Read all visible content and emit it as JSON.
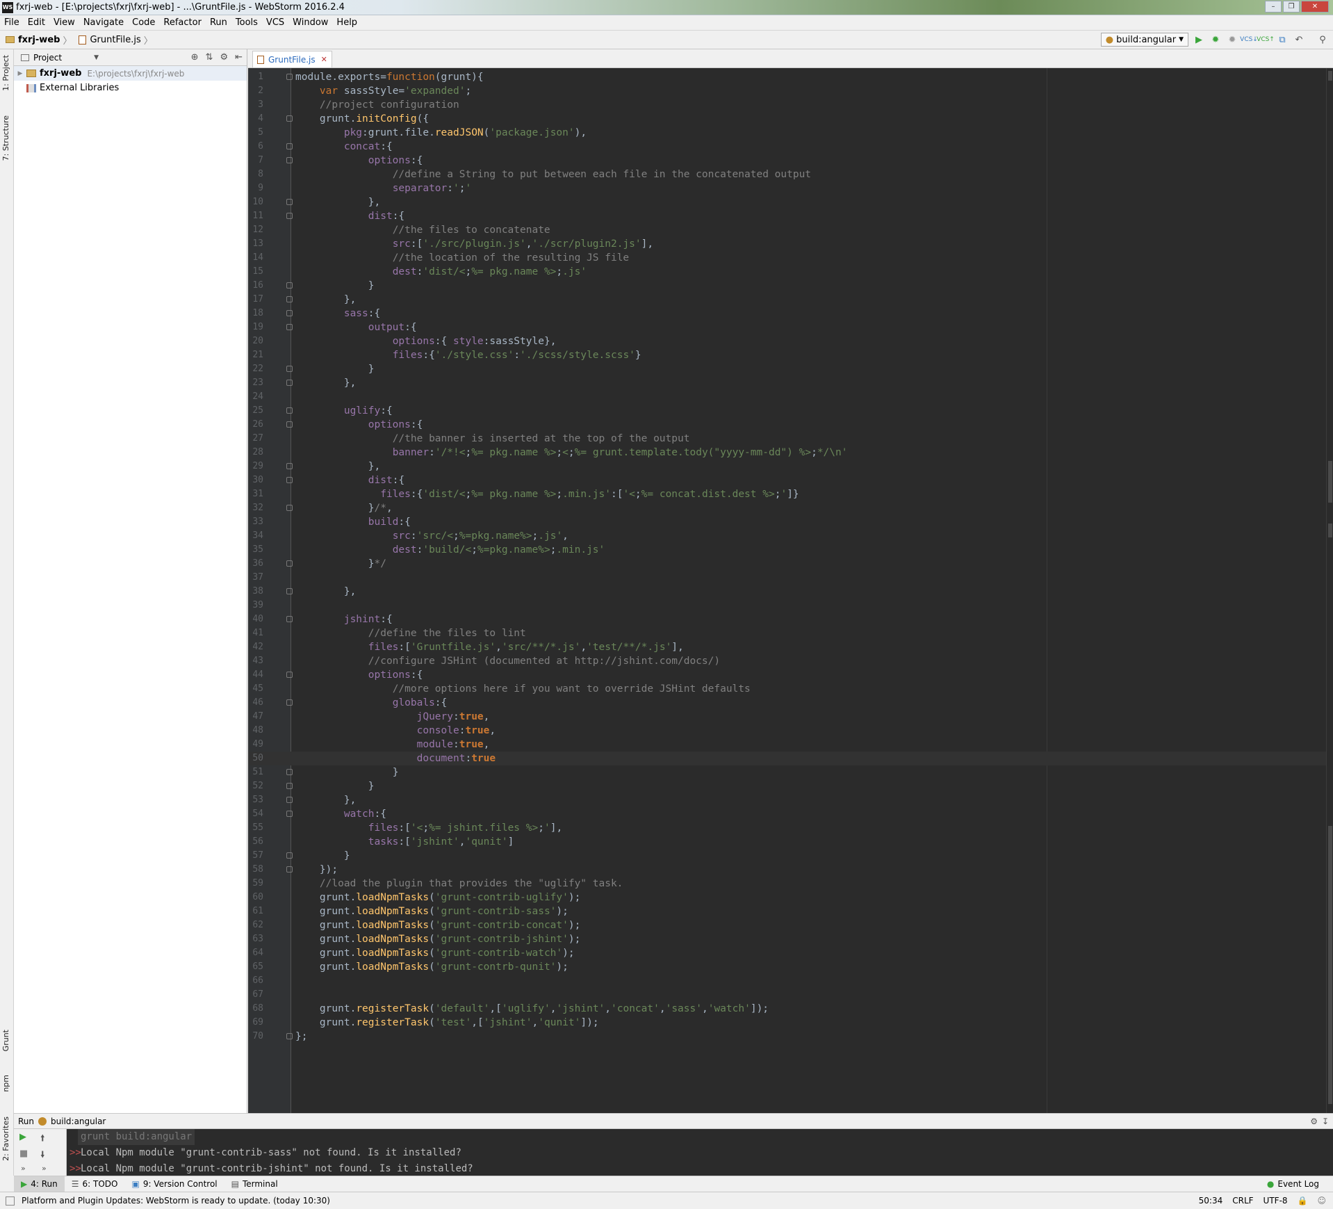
{
  "window": {
    "title": "fxrj-web - [E:\\projects\\fxrj\\fxrj-web] - ...\\GruntFile.js - WebStorm 2016.2.4",
    "app_icon": "WS",
    "buttons": [
      "minimize-icon",
      "restore-icon",
      "close-icon"
    ]
  },
  "menu": [
    "File",
    "Edit",
    "View",
    "Navigate",
    "Code",
    "Refactor",
    "Run",
    "Tools",
    "VCS",
    "Window",
    "Help"
  ],
  "breadcrumb": {
    "project": "fxrj-web",
    "file": "GruntFile.js"
  },
  "toolbar": {
    "run_config": "build:angular",
    "icons": [
      "run-icon",
      "debug-icon",
      "coverage-icon",
      "vcs-update-icon",
      "vcs-commit-icon",
      "compare-icon",
      "revert-icon",
      "search-icon"
    ]
  },
  "left_tabs": {
    "project": "1: Project",
    "structure": "7: Structure",
    "grunt": "Grunt",
    "npm": "npm",
    "favorites": "2: Favorites"
  },
  "project_panel": {
    "header": "Project",
    "tree": [
      {
        "label": "fxrj-web",
        "path": "E:\\projects\\fxrj\\fxrj-web"
      },
      {
        "label": "External Libraries",
        "path": ""
      }
    ]
  },
  "editor": {
    "tab": "GruntFile.js",
    "current_line": 50,
    "lines": [
      "module.exports=function(grunt){",
      "    var sassStyle='expanded';",
      "    //project configuration",
      "    grunt.initConfig({",
      "        pkg:grunt.file.readJSON('package.json'),",
      "        concat:{",
      "            options:{",
      "                //define a String to put between each file in the concatenated output",
      "                separator:';'",
      "            },",
      "            dist:{",
      "                //the files to concatenate",
      "                src:['./src/plugin.js','./scr/plugin2.js'],",
      "                //the location of the resulting JS file",
      "                dest:'dist/<%= pkg.name %>.js'",
      "            }",
      "        },",
      "        sass:{",
      "            output:{",
      "                options:{ style:sassStyle},",
      "                files:{'./style.css':'./scss/style.scss'}",
      "            }",
      "        },",
      "",
      "        uglify:{",
      "            options:{",
      "                //the banner is inserted at the top of the output",
      "                banner:'/*!<%= pkg.name %><%= grunt.template.tody(\"yyyy-mm-dd\") %>*/\\n'",
      "            },",
      "            dist:{",
      "              files:{'dist/<%= pkg.name %>.min.js':['<%= concat.dist.dest %>']}",
      "            }/*,",
      "            build:{",
      "                src:'src/<%=pkg.name%>.js',",
      "                dest:'build/<%=pkg.name%>.min.js'",
      "            }*/",
      "",
      "        },",
      "",
      "        jshint:{",
      "            //define the files to lint",
      "            files:['Gruntfile.js','src/**/*.js','test/**/*.js'],",
      "            //configure JSHint (documented at http://jshint.com/docs/)",
      "            options:{",
      "                //more options here if you want to override JSHint defaults",
      "                globals:{",
      "                    jQuery:true,",
      "                    console:true,",
      "                    module:true,",
      "                    document:true",
      "                }",
      "            }",
      "        },",
      "        watch:{",
      "            files:['<%= jshint.files %>'],",
      "            tasks:['jshint','qunit']",
      "        }",
      "    });",
      "    //load the plugin that provides the \"uglify\" task.",
      "    grunt.loadNpmTasks('grunt-contrib-uglify');",
      "    grunt.loadNpmTasks('grunt-contrib-sass');",
      "    grunt.loadNpmTasks('grunt-contrib-concat');",
      "    grunt.loadNpmTasks('grunt-contrib-jshint');",
      "    grunt.loadNpmTasks('grunt-contrib-watch');",
      "    grunt.loadNpmTasks('grunt-contrb-qunit');",
      "",
      "",
      "    grunt.registerTask('default',['uglify','jshint','concat','sass','watch']);",
      "    grunt.registerTask('test',['jshint','qunit']);",
      "};"
    ],
    "fold_lines": [
      1,
      4,
      6,
      7,
      10,
      11,
      16,
      17,
      18,
      19,
      22,
      23,
      25,
      26,
      29,
      30,
      32,
      36,
      38,
      40,
      44,
      46,
      51,
      52,
      53,
      54,
      57,
      58,
      70
    ]
  },
  "run_panel": {
    "title": "Run",
    "config": "build:angular",
    "command": "grunt build:angular",
    "output": [
      "Local Npm module \"grunt-contrib-sass\" not found. Is it installed?",
      "Local Npm module \"grunt-contrib-jshint\" not found. Is it installed?"
    ]
  },
  "tool_windows": [
    {
      "num": "4",
      "label": "4: Run"
    },
    {
      "num": "6",
      "label": "6: TODO"
    },
    {
      "num": "9",
      "label": "9: Version Control"
    },
    {
      "num": "",
      "label": "Terminal"
    }
  ],
  "event_log": "Event Log",
  "status": {
    "message": "Platform and Plugin Updates: WebStorm is ready to update. (today 10:30)",
    "position": "50:34",
    "line_sep": "CRLF",
    "encoding": "UTF-8"
  },
  "colors": {
    "editor_bg": "#2b2b2b",
    "keyword": "#cc7832",
    "string": "#6a8759",
    "comment": "#808080",
    "property": "#9876aa",
    "function": "#ffc66d"
  }
}
